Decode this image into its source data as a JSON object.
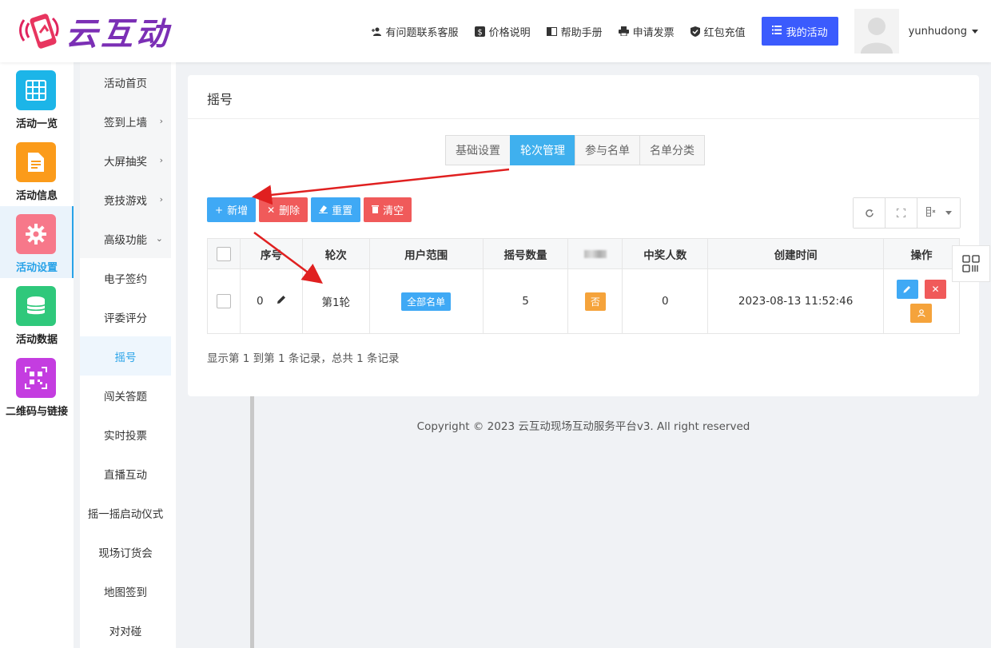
{
  "brand": {
    "logo_text": "云互动"
  },
  "topnav": {
    "links": [
      {
        "label": "有问题联系客服",
        "icon": "add-user-icon"
      },
      {
        "label": "价格说明",
        "icon": "dollar-icon"
      },
      {
        "label": "帮助手册",
        "icon": "book-icon"
      },
      {
        "label": "申请发票",
        "icon": "printer-icon"
      },
      {
        "label": "红包充值",
        "icon": "shield-check-icon"
      }
    ],
    "my_activity": "我的活动",
    "username": "yunhudong"
  },
  "iconbar": {
    "items": [
      {
        "label": "活动一览",
        "icon": "grid-icon",
        "color": "#1cb5e8"
      },
      {
        "label": "活动信息",
        "icon": "document-icon",
        "color": "#fb9b1a"
      },
      {
        "label": "活动设置",
        "icon": "gear-icon",
        "color": "#f7788a",
        "active": true
      },
      {
        "label": "活动数据",
        "icon": "database-icon",
        "color": "#2fc87b"
      },
      {
        "label": "二维码与链接",
        "icon": "qrcode-icon",
        "color": "#c43de0"
      }
    ]
  },
  "submenu": {
    "items": [
      {
        "label": "活动首页",
        "arrow": ""
      },
      {
        "label": "签到上墙",
        "arrow": "›"
      },
      {
        "label": "大屏抽奖",
        "arrow": "›"
      },
      {
        "label": "竞技游戏",
        "arrow": "›"
      },
      {
        "label": "高级功能",
        "arrow": "⌄"
      },
      {
        "label": "电子签约",
        "arrow": ""
      },
      {
        "label": "评委评分",
        "arrow": ""
      },
      {
        "label": "摇号",
        "arrow": "",
        "active": true
      },
      {
        "label": "闯关答题",
        "arrow": ""
      },
      {
        "label": "实时投票",
        "arrow": ""
      },
      {
        "label": "直播互动",
        "arrow": ""
      },
      {
        "label": "摇一摇启动仪式",
        "arrow": ""
      },
      {
        "label": "现场订货会",
        "arrow": ""
      },
      {
        "label": "地图签到",
        "arrow": ""
      },
      {
        "label": "对对碰",
        "arrow": ""
      }
    ]
  },
  "main": {
    "title": "摇号",
    "tabs": [
      {
        "label": "基础设置"
      },
      {
        "label": "轮次管理",
        "active": true
      },
      {
        "label": "参与名单"
      },
      {
        "label": "名单分类"
      }
    ],
    "toolbar": {
      "add": "新增",
      "delete": "删除",
      "reset": "重置",
      "clear": "清空"
    },
    "table": {
      "headers": [
        "序号",
        "轮次",
        "用户范围",
        "摇号数量",
        "",
        "中奖人数",
        "创建时间",
        "操作"
      ],
      "rows": [
        {
          "index": "0",
          "round": "第1轮",
          "scope": "全部名单",
          "count": "5",
          "flag": "否",
          "winners": "0",
          "created": "2023-08-13 11:52:46"
        }
      ]
    },
    "pager": "显示第 1 到第 1 条记录，总共 1 条记录"
  },
  "footer": "Copyright © 2023 云互动现场互动服务平台v3. All right reserved",
  "colors": {
    "accent": "#3fa9f5",
    "danger": "#f05a5a",
    "primary_nav": "#3b5bfd",
    "annotation": "#e02020"
  }
}
